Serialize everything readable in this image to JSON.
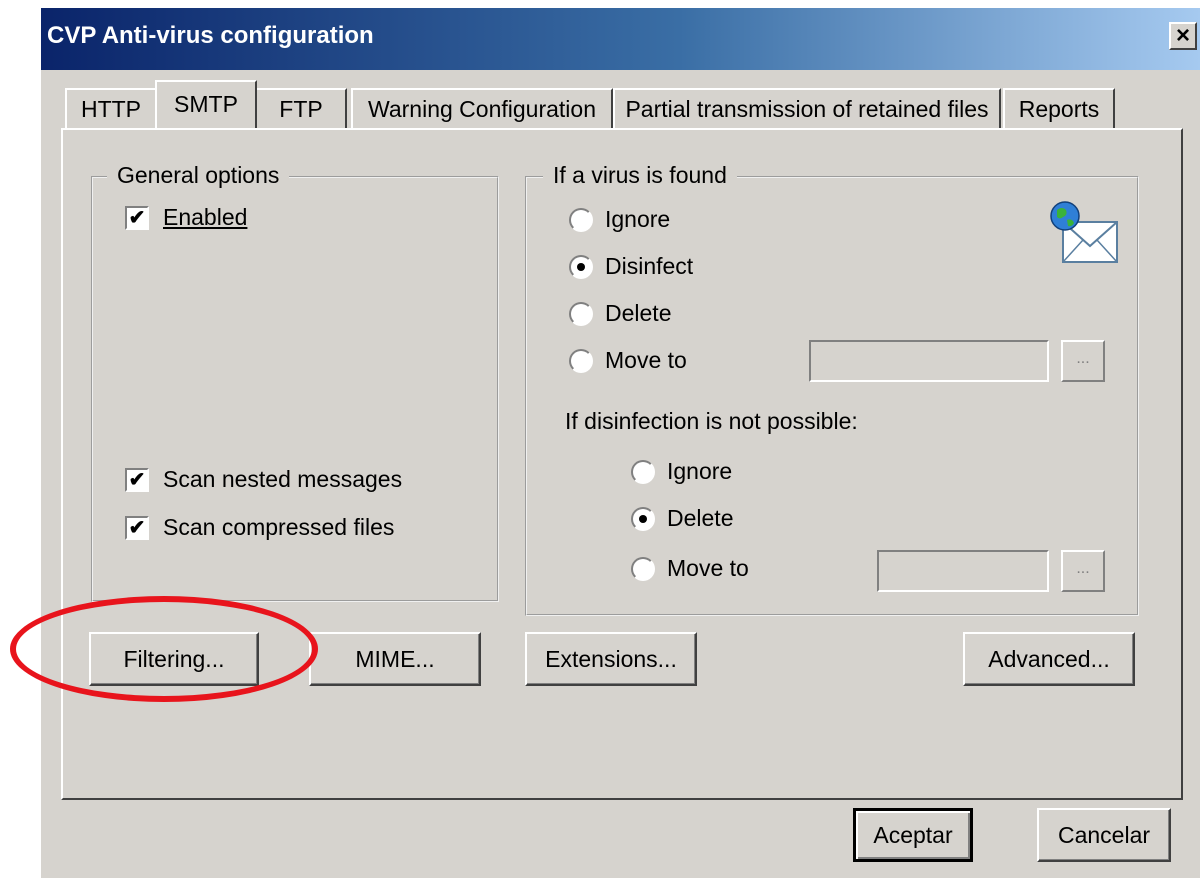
{
  "window": {
    "title": "CVP Anti-virus configuration",
    "close_glyph": "×"
  },
  "tabs": [
    {
      "label": "HTTP",
      "active": false
    },
    {
      "label": "SMTP",
      "active": true
    },
    {
      "label": "FTP",
      "active": false
    },
    {
      "label": "Warning Configuration",
      "active": false
    },
    {
      "label": "Partial transmission of retained files",
      "active": false
    },
    {
      "label": "Reports",
      "active": false
    }
  ],
  "general_options": {
    "title": "General options",
    "enabled": {
      "label": "Enabled",
      "checked": true
    },
    "scan_nested": {
      "label": "Scan nested messages",
      "checked": true
    },
    "scan_compressed": {
      "label": "Scan compressed files",
      "checked": true
    }
  },
  "virus_found": {
    "title": "If a virus is found",
    "icon": "mail-globe-icon",
    "options": {
      "ignore": "Ignore",
      "disinfect": "Disinfect",
      "delete": "Delete",
      "move_to": "Move to"
    },
    "selected": "Disinfect",
    "move_to_path": "",
    "browse_label": "...",
    "disinfection_heading": "If disinfection is not possible:",
    "fallback_options": {
      "ignore": "Ignore",
      "delete": "Delete",
      "move_to": "Move to"
    },
    "fallback_selected": "Delete",
    "fallback_move_to_path": ""
  },
  "buttons": {
    "filtering": "Filtering...",
    "mime": "MIME...",
    "extensions": "Extensions...",
    "advanced": "Advanced...",
    "ok": "Aceptar",
    "cancel": "Cancelar"
  },
  "check_glyph": "✔",
  "colors": {
    "dialog_face": "#d6d3ce",
    "title_start": "#0a246a",
    "title_end": "#a6caf0",
    "highlight_oval": "#e8141c"
  }
}
